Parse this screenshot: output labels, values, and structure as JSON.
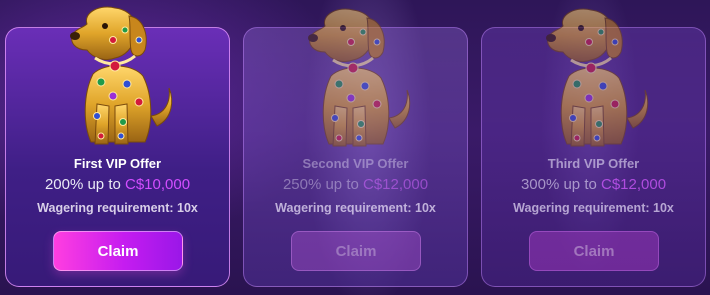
{
  "offers": [
    {
      "title": "First VIP Offer",
      "bonus_prefix": "200% up to ",
      "bonus_amount": "C$10,000",
      "wagering": "Wagering requirement: 10x",
      "claim_label": "Claim",
      "state": "active"
    },
    {
      "title": "Second VIP Offer",
      "bonus_prefix": "250% up to ",
      "bonus_amount": "C$12,000",
      "wagering": "Wagering requirement: 10x",
      "claim_label": "Claim",
      "state": "locked"
    },
    {
      "title": "Third VIP Offer",
      "bonus_prefix": "300% up to ",
      "bonus_amount": "C$12,000",
      "wagering": "Wagering requirement: 10x",
      "claim_label": "Claim",
      "state": "locked"
    }
  ],
  "icons": {
    "offer_image": "jeweled-golden-dog-icon"
  },
  "colors": {
    "accent_amount": "#d24dff",
    "claim_gradient_start": "#ff3ee0",
    "claim_gradient_end": "#9a17e8",
    "background": "#2e1658"
  }
}
